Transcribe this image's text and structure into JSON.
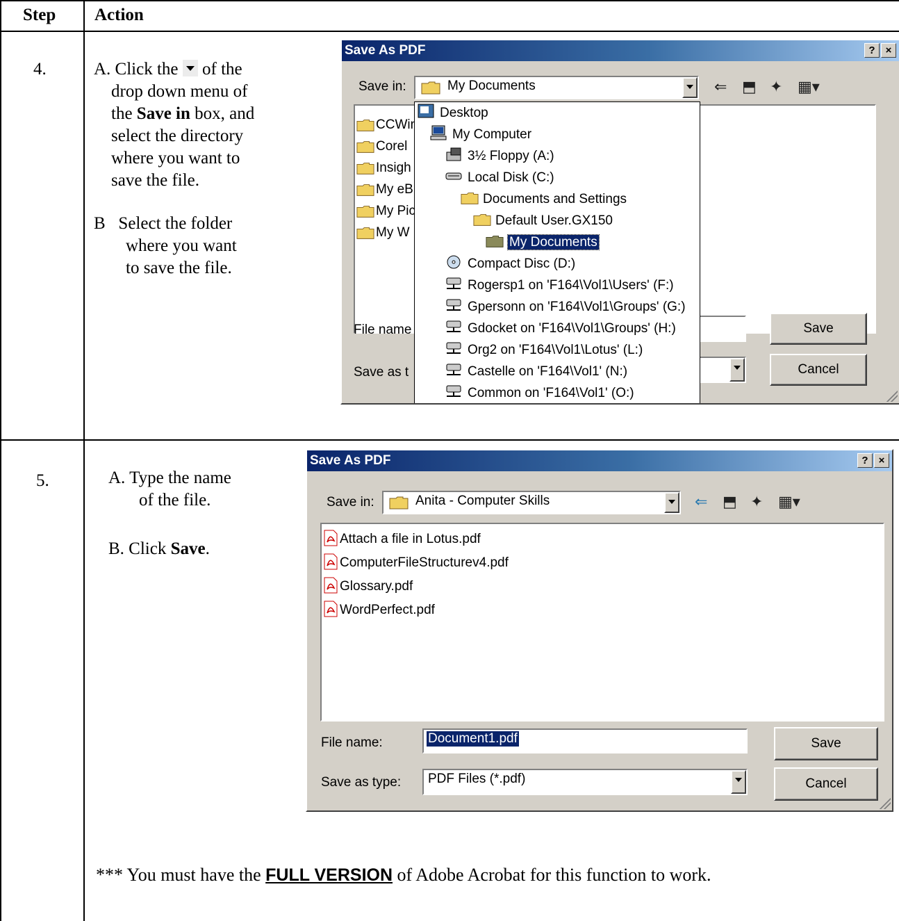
{
  "table": {
    "header_step": "Step",
    "header_action": "Action"
  },
  "step4": {
    "number": "4.",
    "a_prefix": "A. Click the",
    "a_suffix": "of the",
    "a_line2": "drop down menu of",
    "a_line3_pre": "the",
    "a_line3_bold": "Save in",
    "a_line3_post": "box, and",
    "a_line4": "select the directory",
    "a_line5": "where you want to",
    "a_line6": "save the file.",
    "b_line1": "B   Select the folder",
    "b_line2": "where you want",
    "b_line3": "to save the file.",
    "dialog": {
      "title": "Save As PDF",
      "help": "?",
      "close": "×",
      "save_in_label": "Save in:",
      "save_in_value": "My Documents",
      "list_items": [
        "CCWin",
        "Corel",
        "Insigh",
        "My eB",
        "My Pic",
        "My W"
      ],
      "file_name_label": "File name",
      "save_as_label": "Save as t",
      "save_button": "Save",
      "cancel_button": "Cancel",
      "dropdown": [
        {
          "label": "Desktop",
          "icon": "desktop-icon"
        },
        {
          "label": "My Computer",
          "icon": "computer-icon"
        },
        {
          "label": "3½ Floppy (A:)",
          "icon": "floppy-icon"
        },
        {
          "label": "Local Disk (C:)",
          "icon": "disk-icon"
        },
        {
          "label": "Documents and Settings",
          "icon": "folder-icon"
        },
        {
          "label": "Default User.GX150",
          "icon": "folder-icon"
        },
        {
          "label": "My Documents",
          "icon": "open-folder-icon",
          "selected": true
        },
        {
          "label": "Compact Disc (D:)",
          "icon": "cd-icon"
        },
        {
          "label": "Rogersp1 on 'F164\\Vol1\\Users' (F:)",
          "icon": "network-drive-icon"
        },
        {
          "label": "Gpersonn on 'F164\\Vol1\\Groups' (G:)",
          "icon": "network-drive-icon"
        },
        {
          "label": "Gdocket on 'F164\\Vol1\\Groups' (H:)",
          "icon": "network-drive-icon"
        },
        {
          "label": "Org2 on 'F164\\Vol1\\Lotus' (L:)",
          "icon": "network-drive-icon"
        },
        {
          "label": "Castelle on 'F164\\Vol1' (N:)",
          "icon": "network-drive-icon"
        },
        {
          "label": "Common on 'F164\\Vol1' (O:)",
          "icon": "network-drive-icon"
        }
      ]
    }
  },
  "step5": {
    "number": "5.",
    "a_line1": "A. Type the name",
    "a_line2": "of the file.",
    "b_pre": "B. Click",
    "b_bold": "Save",
    "b_post": ".",
    "dialog": {
      "title": "Save As PDF",
      "help": "?",
      "close": "×",
      "save_in_label": "Save in:",
      "save_in_value": "Anita - Computer Skills",
      "files": [
        "Attach a file in Lotus.pdf",
        "ComputerFileStructurev4.pdf",
        "Glossary.pdf",
        "WordPerfect.pdf"
      ],
      "marker": "A",
      "file_name_label": "File name:",
      "file_name_value": "Document1.pdf",
      "save_as_label": "Save as type:",
      "save_as_value": "PDF Files (*.pdf)",
      "save_button": "Save",
      "cancel_button": "Cancel"
    }
  },
  "footer": {
    "pre": "***  You must have the",
    "emph": "FULL VERSION",
    "post": "of Adobe Acrobat for this function to work."
  }
}
